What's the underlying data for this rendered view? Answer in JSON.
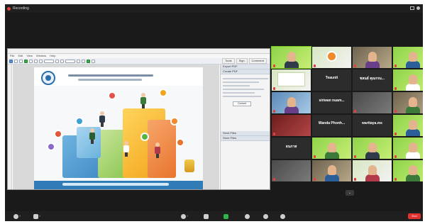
{
  "app": {
    "recording_label": "Recording",
    "end_button_label": "End"
  },
  "shared_window": {
    "title": "",
    "menu": [
      "File",
      "Edit",
      "View",
      "Window",
      "Help"
    ],
    "panel_tabs": [
      "Tools",
      "Sign",
      "Comment"
    ],
    "side_sections": {
      "export_pdf": "Export PDF",
      "create_pdf": "Create PDF",
      "send_files": "Send Files",
      "store_files": "Store Files",
      "convert_button": "Convert"
    }
  },
  "participants": [
    {
      "name": "",
      "style": "green",
      "kind": "person"
    },
    {
      "name": "",
      "style": "light",
      "kind": "logo"
    },
    {
      "name": "",
      "style": "room",
      "kind": "person"
    },
    {
      "name": "",
      "style": "green",
      "kind": "person"
    },
    {
      "name": "",
      "style": "light",
      "kind": "slide"
    },
    {
      "name": "Teaunit",
      "style": "dark",
      "kind": "text"
    },
    {
      "name": "ชลนธ์ คุณรรม...",
      "style": "dark",
      "kind": "text"
    },
    {
      "name": "",
      "style": "green",
      "kind": "person"
    },
    {
      "name": "",
      "style": "blue",
      "kind": "person"
    },
    {
      "name": "siriwan nuam...",
      "style": "dark",
      "kind": "text"
    },
    {
      "name": "",
      "style": "gray",
      "kind": "dark"
    },
    {
      "name": "",
      "style": "room",
      "kind": "person"
    },
    {
      "name": "",
      "style": "red",
      "kind": "dark"
    },
    {
      "name": "Wanda Phonh...",
      "style": "dark",
      "kind": "text"
    },
    {
      "name": "warttaya.ms",
      "style": "dark",
      "kind": "text"
    },
    {
      "name": "",
      "style": "green",
      "kind": "person"
    },
    {
      "name": "ธนภาส",
      "style": "dark",
      "kind": "text"
    },
    {
      "name": "",
      "style": "green",
      "kind": "person"
    },
    {
      "name": "",
      "style": "green",
      "kind": "person"
    },
    {
      "name": "",
      "style": "green",
      "kind": "person"
    },
    {
      "name": "",
      "style": "gray",
      "kind": "dark"
    },
    {
      "name": "",
      "style": "room",
      "kind": "person"
    },
    {
      "name": "",
      "style": "light",
      "kind": "person"
    },
    {
      "name": "",
      "style": "green",
      "kind": "person"
    }
  ]
}
